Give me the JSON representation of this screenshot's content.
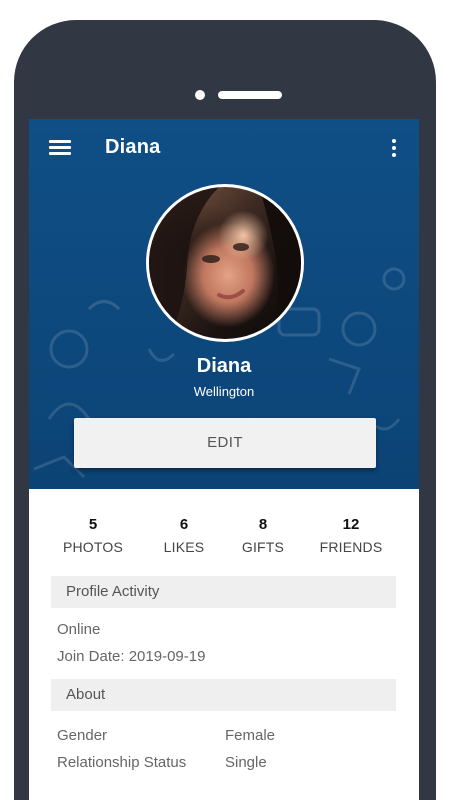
{
  "toolbar": {
    "title": "Diana",
    "menu_icon": "hamburger-menu-icon",
    "more_icon": "more-vert-icon"
  },
  "profile": {
    "name": "Diana",
    "city": "Wellington",
    "edit_label": "EDIT"
  },
  "stats": [
    {
      "value": "5",
      "label": "PHOTOS"
    },
    {
      "value": "6",
      "label": "LIKES"
    },
    {
      "value": "8",
      "label": "GIFTS"
    },
    {
      "value": "12",
      "label": "FRIENDS"
    }
  ],
  "activity": {
    "title": "Profile Activity",
    "status": "Online",
    "join_date": "Join Date: 2019-09-19"
  },
  "about": {
    "title": "About",
    "gender_label": "Gender",
    "gender_value": "Female",
    "relationship_label": "Relationship Status",
    "relationship_value": "Single"
  },
  "colors": {
    "header": "#0f4f86",
    "frame": "#313743",
    "section_bg": "#efefef"
  }
}
